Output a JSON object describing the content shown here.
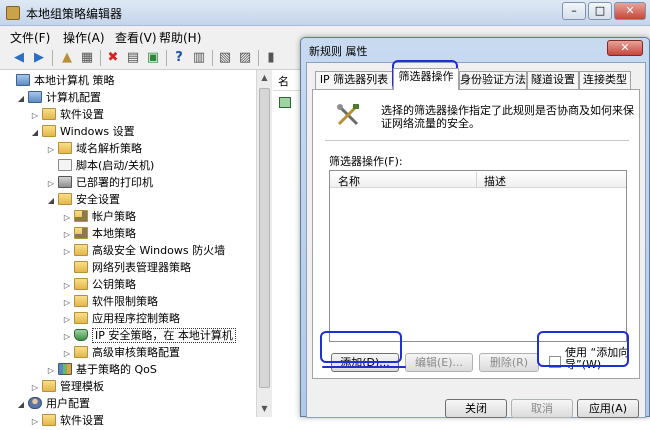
{
  "window": {
    "title": "本地组策略编辑器",
    "controls": {
      "minimize": "–",
      "maximize": "□",
      "close": "✕"
    }
  },
  "menu": [
    "文件(F)",
    "操作(A)",
    "查看(V)",
    "帮助(H)"
  ],
  "tree": {
    "column_header": "名",
    "items": [
      {
        "label": "本地计算机 策略",
        "icon": "computer-policy-icon",
        "expand": ""
      },
      {
        "label": "计算机配置",
        "icon": "computer-icon",
        "expand": "◢"
      },
      {
        "label": "软件设置",
        "icon": "folder-icon",
        "expand": "▷"
      },
      {
        "label": "Windows 设置",
        "icon": "folder-icon",
        "expand": "◢"
      },
      {
        "label": "域名解析策略",
        "icon": "folder-icon",
        "expand": "▷"
      },
      {
        "label": "脚本(启动/关机)",
        "icon": "script-icon",
        "expand": ""
      },
      {
        "label": "已部署的打印机",
        "icon": "printer-icon",
        "expand": "▷"
      },
      {
        "label": "安全设置",
        "icon": "folder-icon",
        "expand": "◢"
      },
      {
        "label": "帐户策略",
        "icon": "lock-folder-icon",
        "expand": "▷"
      },
      {
        "label": "本地策略",
        "icon": "lock-folder-icon",
        "expand": "▷"
      },
      {
        "label": "高级安全 Windows 防火墙",
        "icon": "folder-icon",
        "expand": "▷"
      },
      {
        "label": "网络列表管理器策略",
        "icon": "folder-icon",
        "expand": ""
      },
      {
        "label": "公钥策略",
        "icon": "folder-icon",
        "expand": "▷"
      },
      {
        "label": "软件限制策略",
        "icon": "folder-icon",
        "expand": "▷"
      },
      {
        "label": "应用程序控制策略",
        "icon": "folder-icon",
        "expand": "▷"
      },
      {
        "label": "IP 安全策略，在 本地计算机",
        "icon": "ip-security-icon",
        "expand": "▷"
      },
      {
        "label": "高级审核策略配置",
        "icon": "folder-icon",
        "expand": "▷"
      },
      {
        "label": "基于策略的 QoS",
        "icon": "qos-icon",
        "expand": "▷"
      },
      {
        "label": "管理模板",
        "icon": "folder-icon",
        "expand": "▷"
      },
      {
        "label": "用户配置",
        "icon": "user-icon",
        "expand": "◢"
      },
      {
        "label": "软件设置",
        "icon": "folder-icon",
        "expand": "▷"
      }
    ]
  },
  "dialog": {
    "title": "新规则 属性",
    "close": "✕",
    "tabs": [
      {
        "label": "IP 筛选器列表",
        "active": false
      },
      {
        "label": "筛选器操作",
        "active": true
      },
      {
        "label": "身份验证方法",
        "active": false
      },
      {
        "label": "隧道设置",
        "active": false
      },
      {
        "label": "连接类型",
        "active": false
      }
    ],
    "description": "选择的筛选器操作指定了此规则是否协商及如何来保证网络流量的安全。",
    "list_label": "筛选器操作(F):",
    "columns": [
      "名称",
      "描述"
    ],
    "rows": [],
    "buttons": {
      "add": "添加(D)...",
      "edit": "编辑(E)...",
      "remove": "删除(R)",
      "wizard": "使用 “添加向导”(W)"
    },
    "footer": {
      "close": "关闭",
      "cancel": "取消",
      "apply": "应用(A)"
    }
  },
  "colors": {
    "annotation": "#1f2fd6",
    "titlebar": "#c4d5ea"
  }
}
